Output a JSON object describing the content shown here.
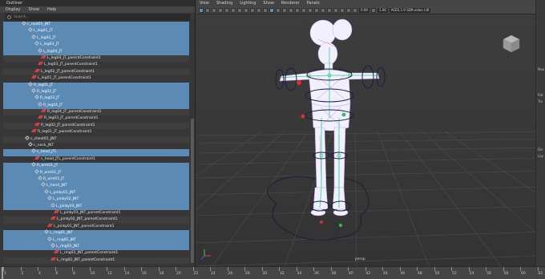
{
  "outliner": {
    "title": "Outliner",
    "menu": [
      "Display",
      "Show",
      "Help"
    ],
    "search_placeholder": "Search...",
    "rows": [
      {
        "label": "c_root01_JNT",
        "indent": 6,
        "kind": "joint",
        "sel": true
      },
      {
        "label": "L_leg01_JT",
        "indent": 8,
        "kind": "joint",
        "sel": true
      },
      {
        "label": "L_leg02_JT",
        "indent": 9,
        "kind": "joint",
        "sel": true
      },
      {
        "label": "L_leg03_JT",
        "indent": 10,
        "kind": "joint",
        "sel": true
      },
      {
        "label": "L_leg04_JT",
        "indent": 11,
        "kind": "joint",
        "sel": true
      },
      {
        "label": "L_leg04_JT_parentConstraint1",
        "indent": 12,
        "kind": "constraint",
        "sel": false
      },
      {
        "label": "L_leg03_JT_parentConstraint1",
        "indent": 11,
        "kind": "constraint",
        "sel": false
      },
      {
        "label": "L_leg02_JT_parentConstraint1",
        "indent": 10,
        "kind": "constraint",
        "sel": false
      },
      {
        "label": "L_leg01_JT_parentConstraint1",
        "indent": 9,
        "kind": "constraint",
        "sel": false
      },
      {
        "label": "R_leg01_JT",
        "indent": 8,
        "kind": "joint",
        "sel": true
      },
      {
        "label": "R_leg02_JT",
        "indent": 9,
        "kind": "joint",
        "sel": true
      },
      {
        "label": "R_leg03_JT",
        "indent": 10,
        "kind": "joint",
        "sel": true
      },
      {
        "label": "R_leg04_JT",
        "indent": 11,
        "kind": "joint",
        "sel": true
      },
      {
        "label": "R_leg04_JT_parentConstraint1",
        "indent": 12,
        "kind": "constraint",
        "sel": false
      },
      {
        "label": "R_leg03_JT_parentConstraint1",
        "indent": 11,
        "kind": "constraint",
        "sel": false
      },
      {
        "label": "R_leg02_JT_parentConstraint1",
        "indent": 10,
        "kind": "constraint",
        "sel": false
      },
      {
        "label": "R_leg01_JT_parentConstraint1",
        "indent": 9,
        "kind": "constraint",
        "sel": false
      },
      {
        "label": "c_chest01_JNT",
        "indent": 7,
        "kind": "joint",
        "sel": false
      },
      {
        "label": "c_neck_JNT",
        "indent": 8,
        "kind": "joint",
        "sel": false
      },
      {
        "label": "c_head_JTL",
        "indent": 9,
        "kind": "joint",
        "sel": true
      },
      {
        "label": "c_head_JTL_parentConstraint1",
        "indent": 10,
        "kind": "constraint",
        "sel": false
      },
      {
        "label": "R_arm01_JT",
        "indent": 9,
        "kind": "joint",
        "sel": true
      },
      {
        "label": "R_arm02_JT",
        "indent": 10,
        "kind": "joint",
        "sel": true
      },
      {
        "label": "R_arm03_JT",
        "indent": 11,
        "kind": "joint",
        "sel": true
      },
      {
        "label": "L_hand_JNT",
        "indent": 12,
        "kind": "joint",
        "sel": true
      },
      {
        "label": "L_pinky01_JNT",
        "indent": 13,
        "kind": "joint",
        "sel": true
      },
      {
        "label": "L_pinky02_JNT",
        "indent": 14,
        "kind": "joint",
        "sel": true
      },
      {
        "label": "L_pinky03_JNT",
        "indent": 15,
        "kind": "joint",
        "sel": true
      },
      {
        "label": "L_pinky03_JNT_parentConstraint1",
        "indent": 16,
        "kind": "constraint",
        "sel": false
      },
      {
        "label": "L_pinky02_JNT_parentConstraint1",
        "indent": 15,
        "kind": "constraint",
        "sel": false
      },
      {
        "label": "L_pinky01_JNT_parentConstraint1",
        "indent": 14,
        "kind": "constraint",
        "sel": false
      },
      {
        "label": "L_ring01_JNT",
        "indent": 13,
        "kind": "joint",
        "sel": true
      },
      {
        "label": "L_ring02_JNT",
        "indent": 14,
        "kind": "joint",
        "sel": true
      },
      {
        "label": "L_ring03_JNT",
        "indent": 15,
        "kind": "joint",
        "sel": true
      },
      {
        "label": "L_ring03_JNT_parentConstraint1",
        "indent": 16,
        "kind": "constraint",
        "sel": false
      },
      {
        "label": "L_ring02_JNT_parentConstraint1",
        "indent": 15,
        "kind": "constraint",
        "sel": false
      }
    ]
  },
  "viewport": {
    "menu": [
      "View",
      "Shading",
      "Lighting",
      "Show",
      "Renderer",
      "Panels"
    ],
    "field_a": "0.00",
    "field_b": "1.00",
    "color_space": "ACES 1.0 SDR-video (sR",
    "camera_label": "persp"
  },
  "right_strip": {
    "labels": [
      "Man",
      "Rot",
      "Tra",
      "Dis",
      "Lay"
    ]
  },
  "timeline": {
    "frames": [
      "1",
      "2",
      "4",
      "6",
      "8",
      "10",
      "12",
      "14",
      "16",
      "18",
      "20",
      "22",
      "24",
      "26",
      "28",
      "30",
      "32",
      "34",
      "36",
      "38",
      "40",
      "42",
      "44",
      "46",
      "48",
      "50",
      "52",
      "54",
      "56",
      "58",
      "60",
      "62"
    ]
  },
  "colors": {
    "selection": "#5b8bb5",
    "wireframe": "#d8d8ff",
    "constraint": "#d04040"
  }
}
